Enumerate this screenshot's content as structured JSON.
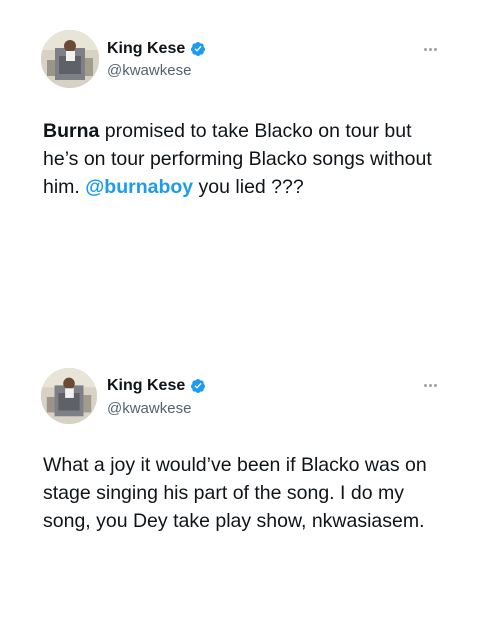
{
  "tweets": [
    {
      "display_name": "King Kese",
      "handle": "@kwawkese",
      "text_bold": "Burna",
      "text_main": " promised to take Blacko on tour but he’s on tour performing Blacko songs without him. ",
      "mention": "@burnaboy",
      "text_end": " you lied ???"
    },
    {
      "display_name": "King Kese",
      "handle": "@kwawkese",
      "text": "What a joy it would’ve been if Blacko was on stage singing his part of the song. I do my song, you Dey take play show, nkwasiasem."
    }
  ],
  "colors": {
    "text": "#0f1419",
    "secondary": "#536471",
    "link": "#1d9bf0",
    "verified": "#1d9bf0"
  },
  "icons": {
    "verified": "verified-badge-icon",
    "more": "more-options-icon"
  }
}
